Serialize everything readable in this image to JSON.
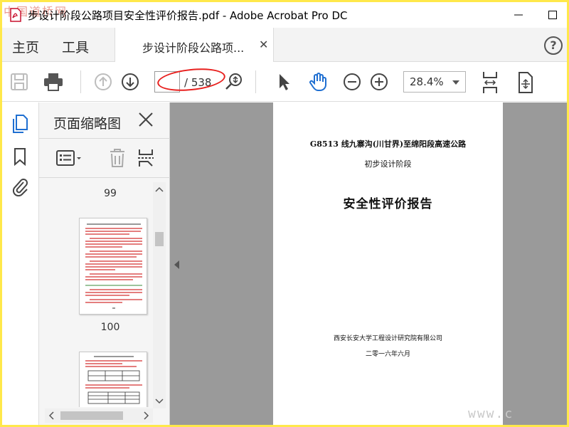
{
  "window": {
    "title": "步设计阶段公路项目安全性评价报告.pdf - Adobe Acrobat Pro DC",
    "watermark_logo": "中国道桥网",
    "watermark_url": "www.c"
  },
  "tabs": {
    "home": "主页",
    "tools": "工具",
    "doc": "步设计阶段公路项...",
    "help": "?"
  },
  "toolbar": {
    "page_current": "",
    "page_total": "/ 538",
    "zoom": "28.4%"
  },
  "panel": {
    "title": "页面缩略图",
    "pages": [
      "99",
      "100"
    ]
  },
  "document": {
    "line1": "G8513 线九寨沟(川甘界)至绵阳段高速公路",
    "line2": "初步设计阶段",
    "title": "安全性评价报告",
    "org": "西安长安大学工程设计研究院有限公司",
    "date": "二零一六年六月"
  },
  "colors": {
    "accent_blue": "#1f6fd1",
    "annotation_red": "#e8201e",
    "frame_yellow": "#ffe84a"
  }
}
